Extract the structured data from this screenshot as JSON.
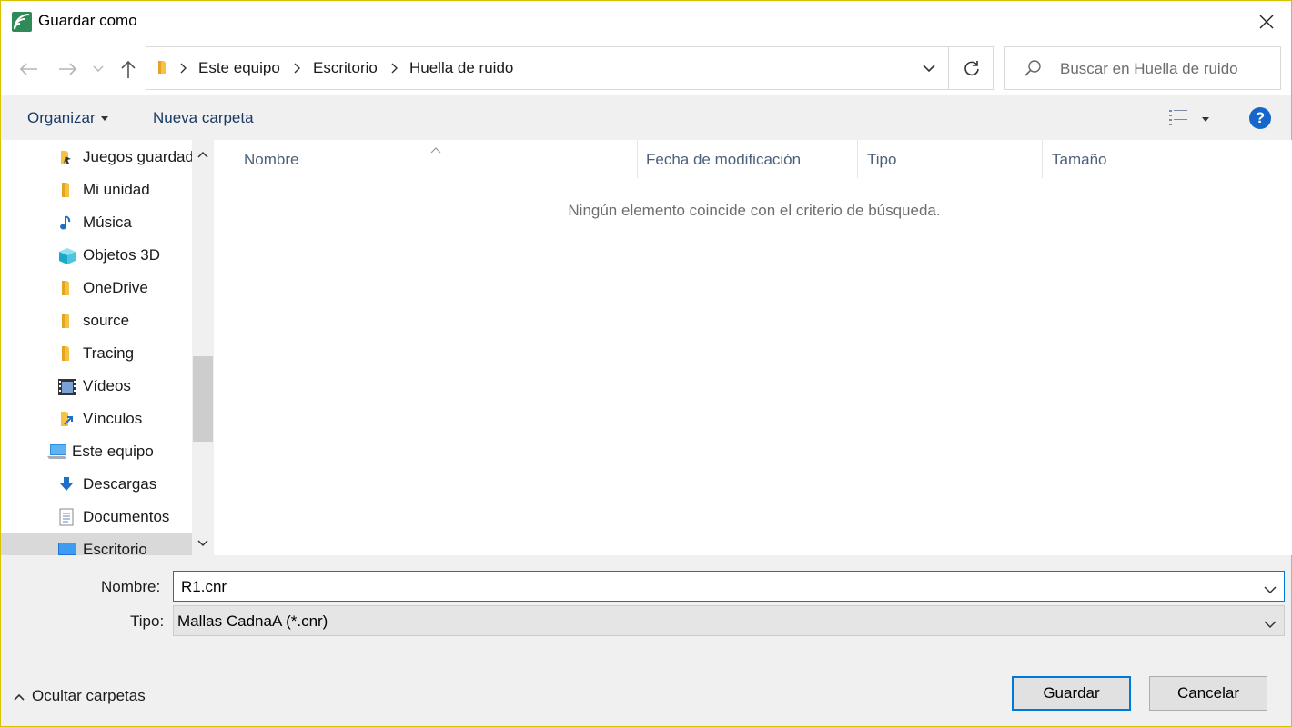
{
  "window": {
    "title": "Guardar como"
  },
  "address": {
    "crumbs": [
      "Este equipo",
      "Escritorio",
      "Huella de ruido"
    ]
  },
  "search": {
    "placeholder": "Buscar en Huella de ruido"
  },
  "commands": {
    "organize": "Organizar",
    "new_folder": "Nueva carpeta",
    "help": "?"
  },
  "nav": {
    "items": [
      {
        "label": "Juegos guardados",
        "icon": "saved-games-icon"
      },
      {
        "label": "Mi unidad",
        "icon": "folder-icon"
      },
      {
        "label": "Música",
        "icon": "music-icon"
      },
      {
        "label": "Objetos 3D",
        "icon": "objects-3d-icon"
      },
      {
        "label": "OneDrive",
        "icon": "folder-icon"
      },
      {
        "label": "source",
        "icon": "folder-icon"
      },
      {
        "label": "Tracing",
        "icon": "folder-icon"
      },
      {
        "label": "Vídeos",
        "icon": "videos-icon"
      },
      {
        "label": "Vínculos",
        "icon": "links-icon"
      },
      {
        "label": "Este equipo",
        "icon": "this-pc-icon"
      },
      {
        "label": "Descargas",
        "icon": "downloads-icon"
      },
      {
        "label": "Documentos",
        "icon": "documents-icon"
      },
      {
        "label": "Escritorio",
        "icon": "desktop-icon",
        "selected": true
      }
    ]
  },
  "filelist": {
    "columns": [
      "Nombre",
      "Fecha de modificación",
      "Tipo",
      "Tamaño"
    ],
    "empty_message": "Ningún elemento coincide con el criterio de búsqueda."
  },
  "form": {
    "name_label": "Nombre:",
    "name_value": "R1.cnr",
    "type_label": "Tipo:",
    "type_value": "Mallas CadnaA (*.cnr)"
  },
  "footer": {
    "hide_folders": "Ocultar carpetas",
    "save": "Guardar",
    "cancel": "Cancelar"
  }
}
